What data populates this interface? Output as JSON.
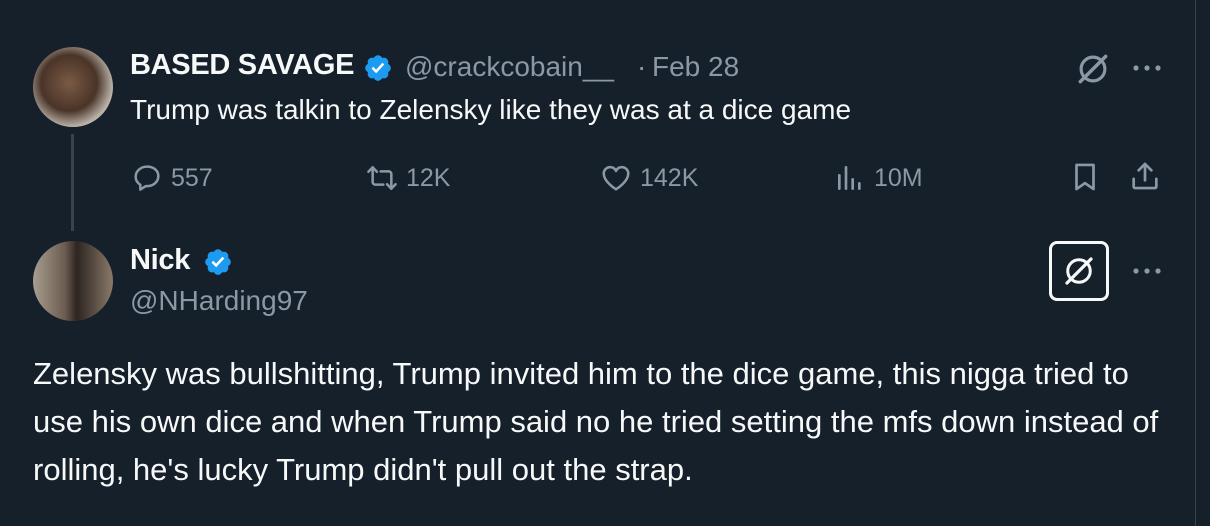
{
  "tweet1": {
    "display_name": "BASED SAVAGE",
    "handle": "@crackcobain__",
    "separator": "·",
    "date": "Feb 28",
    "text": "Trump was talkin to Zelensky like they was at a dice game",
    "stats": {
      "replies": "557",
      "retweets": "12K",
      "likes": "142K",
      "views": "10M"
    }
  },
  "tweet2": {
    "display_name": "Nick",
    "handle": "@NHarding97",
    "text": "Zelensky was bullshitting, Trump invited him to the dice game, this nigga tried to use his own dice and when Trump said no he tried setting the mfs down instead of rolling, he's lucky Trump didn't pull out the strap."
  },
  "colors": {
    "background": "#15202b",
    "text_primary": "#f7f9f9",
    "text_secondary": "#8b98a5",
    "verified": "#1d9bf0",
    "divider": "#38444d"
  },
  "icons": {
    "reply": "reply-icon",
    "retweet": "retweet-icon",
    "like": "heart-icon",
    "views": "views-icon",
    "bookmark": "bookmark-icon",
    "share": "share-icon",
    "grok": "grok-icon",
    "more": "more-icon"
  }
}
